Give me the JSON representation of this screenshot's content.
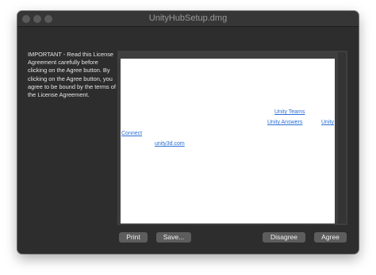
{
  "window": {
    "title": "UnityHubSetup.dmg"
  },
  "license": {
    "intro": "IMPORTANT - Read this License Agreement carefully before clicking on the Agree button. By clicking on the Agree button, you agree to be bound by the terms of the License Agreement."
  },
  "links": {
    "unity_teams": "Unity Teams",
    "unity_answers": "Unity Answers",
    "unity_cut": "Unity",
    "connect": "Connect",
    "unity3d": "unity3d.com"
  },
  "buttons": {
    "print": "Print",
    "save": "Save...",
    "disagree": "Disagree",
    "agree": "Agree"
  }
}
